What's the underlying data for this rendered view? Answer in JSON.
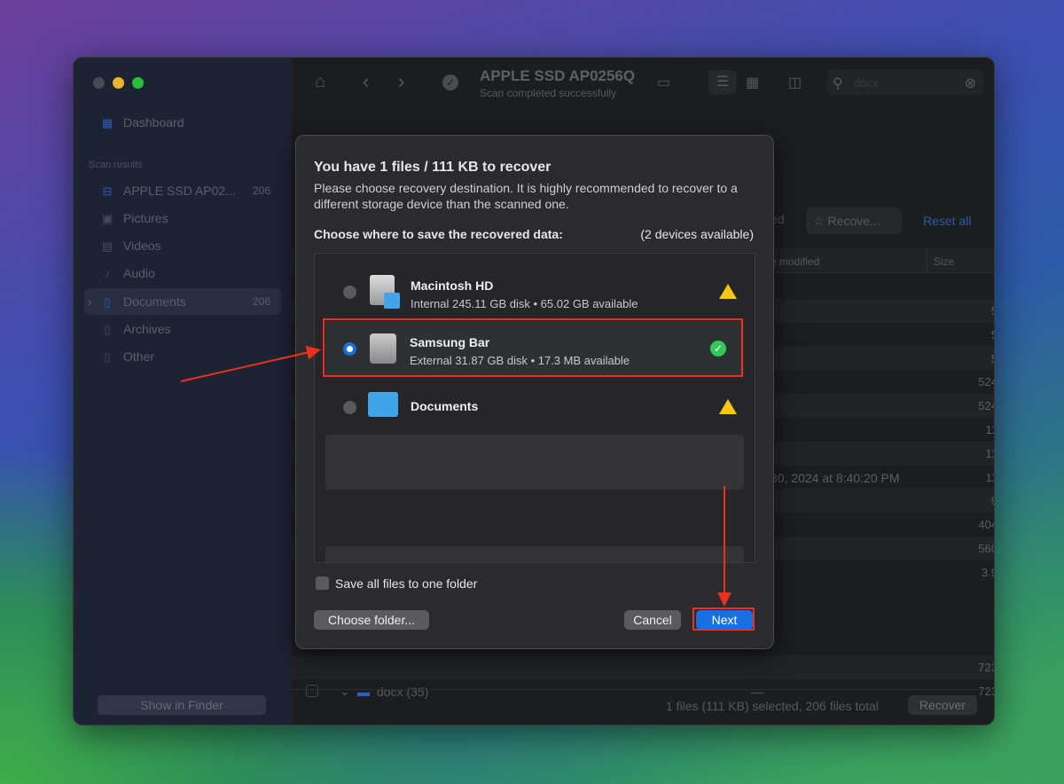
{
  "window": {
    "title": "APPLE SSD AP0256Q",
    "subtitle": "Scan completed successfully",
    "search_value": "docx"
  },
  "sidebar": {
    "dashboard": "Dashboard",
    "section": "Scan results",
    "items": [
      {
        "label": "APPLE SSD AP02...",
        "count": "206",
        "icon": "drive-icon"
      },
      {
        "label": "Pictures",
        "icon": "picture-icon"
      },
      {
        "label": "Videos",
        "icon": "film-icon"
      },
      {
        "label": "Audio",
        "icon": "music-note-icon"
      },
      {
        "label": "Documents",
        "count": "206",
        "icon": "document-icon"
      },
      {
        "label": "Archives",
        "icon": "archive-icon"
      },
      {
        "label": "Other",
        "icon": "file-icon"
      }
    ],
    "show_in_finder": "Show in Finder"
  },
  "toolbar": {
    "filter_partial": "ed",
    "recovery_chances": "Recove...",
    "reset_all": "Reset all"
  },
  "table": {
    "col_modified": "e modified",
    "col_size": "Size",
    "date_cell": "30, 2024 at 8:40:20 PM",
    "sizes": [
      "5",
      "5",
      "5",
      "524",
      "524",
      "11",
      "11",
      "11",
      "9",
      "404",
      "560",
      "3.9"
    ],
    "group_row": {
      "label": "docx (35)",
      "date": "—",
      "sizes": [
        "723",
        "723"
      ]
    }
  },
  "status": {
    "text": "1 files (111 KB) selected, 206 files total",
    "recover": "Recover"
  },
  "dialog": {
    "title": "You have 1 files / 111 KB to recover",
    "description": "Please choose recovery destination. It is highly recommended to recover to a different storage device than the scanned one.",
    "choose_label": "Choose where to save the recovered data:",
    "devices_available": "(2 devices available)",
    "devices": [
      {
        "name": "Macintosh HD",
        "detail": "Internal 245.11 GB disk • 65.02 GB available",
        "status": "warning",
        "selected": false
      },
      {
        "name": "Samsung Bar",
        "detail": "External 31.87 GB disk • 17.3 MB available",
        "status": "ok",
        "selected": true
      },
      {
        "name": "Documents",
        "detail": "",
        "status": "warning",
        "selected": false
      }
    ],
    "save_one_folder": "Save all files to one folder",
    "choose_folder": "Choose folder...",
    "cancel": "Cancel",
    "next": "Next"
  },
  "colors": {
    "accent": "#1a6fe0",
    "annotation": "#e8321f",
    "warning": "#f5c518",
    "ok": "#34c759"
  }
}
